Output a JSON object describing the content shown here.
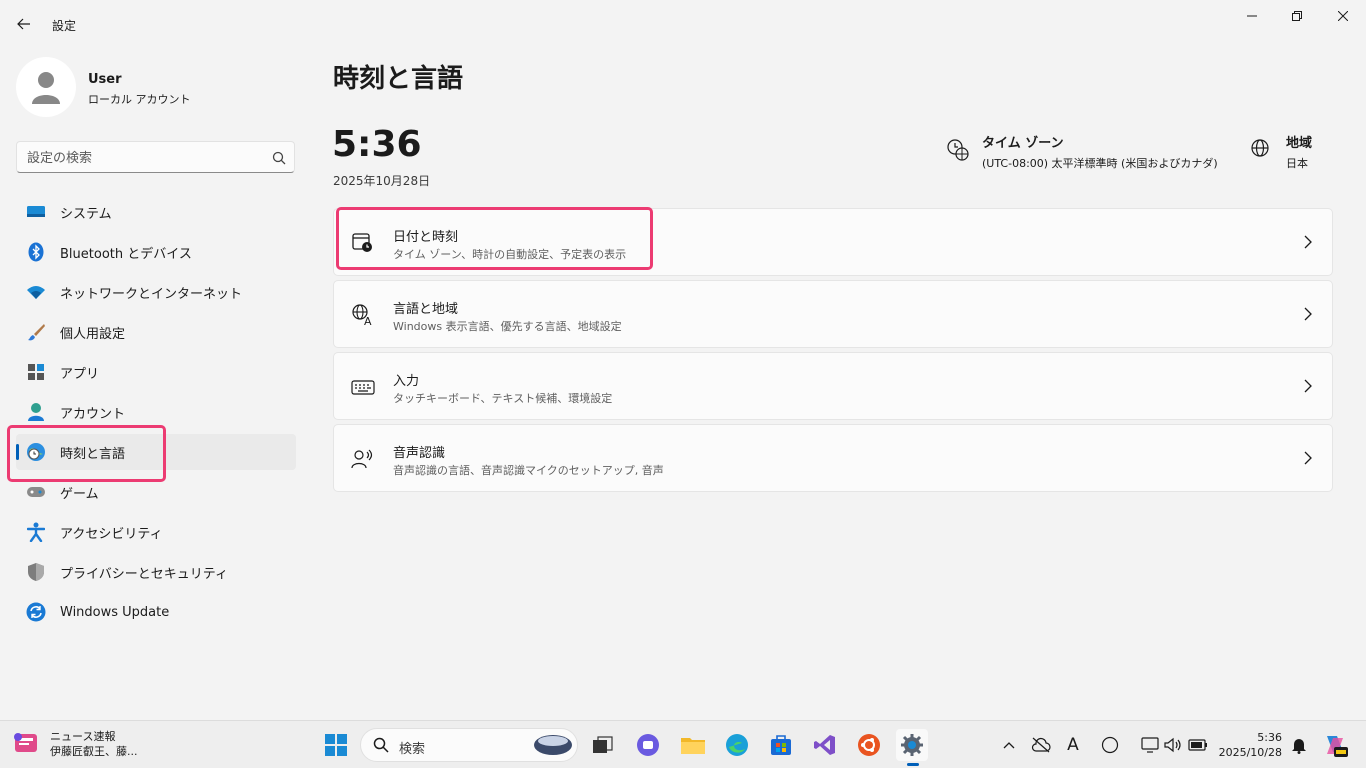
{
  "window": {
    "title": "設定"
  },
  "user": {
    "name": "User",
    "account_type": "ローカル アカウント"
  },
  "search": {
    "placeholder": "設定の検索"
  },
  "nav": {
    "items": [
      {
        "label": "システム",
        "icon": "system-icon"
      },
      {
        "label": "Bluetooth とデバイス",
        "icon": "bluetooth-icon"
      },
      {
        "label": "ネットワークとインターネット",
        "icon": "wifi-icon"
      },
      {
        "label": "個人用設定",
        "icon": "brush-icon"
      },
      {
        "label": "アプリ",
        "icon": "apps-icon"
      },
      {
        "label": "アカウント",
        "icon": "account-icon"
      },
      {
        "label": "時刻と言語",
        "icon": "time-language-icon",
        "selected": true
      },
      {
        "label": "ゲーム",
        "icon": "gamepad-icon"
      },
      {
        "label": "アクセシビリティ",
        "icon": "accessibility-icon"
      },
      {
        "label": "プライバシーとセキュリティ",
        "icon": "shield-icon"
      },
      {
        "label": "Windows Update",
        "icon": "update-icon"
      }
    ]
  },
  "main": {
    "title": "時刻と言語",
    "time": "5:36",
    "date": "2025年10月28日",
    "timezone": {
      "title": "タイム ゾーン",
      "value": "(UTC-08:00) 太平洋標準時 (米国およびカナダ)"
    },
    "region": {
      "title": "地域",
      "value": "日本"
    },
    "cards": [
      {
        "title": "日付と時刻",
        "subtitle": "タイム ゾーン、時計の自動設定、予定表の表示",
        "icon": "calendar-clock-icon"
      },
      {
        "title": "言語と地域",
        "subtitle": "Windows 表示言語、優先する言語、地域設定",
        "icon": "language-icon"
      },
      {
        "title": "入力",
        "subtitle": "タッチキーボード、テキスト候補、環境設定",
        "icon": "keyboard-icon"
      },
      {
        "title": "音声認識",
        "subtitle": "音声認識の言語、音声認識マイクのセットアップ, 音声",
        "icon": "speech-icon"
      }
    ]
  },
  "taskbar": {
    "news": {
      "title": "ニュース速報",
      "text": "伊藤匠叡王、藤..."
    },
    "search_label": "検索",
    "clock_time": "5:36",
    "clock_date": "2025/10/28",
    "tray_font_indicator": "A"
  },
  "colors": {
    "accent": "#005fb8",
    "highlight": "#ec3b72"
  }
}
